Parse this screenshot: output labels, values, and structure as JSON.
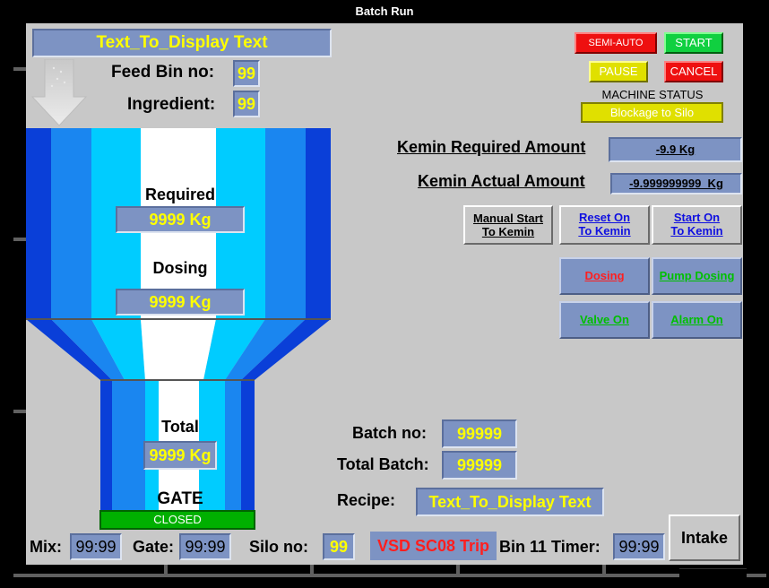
{
  "window": {
    "title": "Batch Run"
  },
  "header": {
    "display_text": "Text_To_Display Text"
  },
  "feed": {
    "label": "Feed Bin no:",
    "value": "99",
    "ingredient_label": "Ingredient:",
    "ingredient_value": "99"
  },
  "hopper": {
    "required_label": "Required",
    "required_value": "9999 Kg",
    "dosing_label": "Dosing",
    "dosing_value": "9999 Kg",
    "total_label": "Total",
    "total_value": "9999 Kg",
    "gate_label": "GATE",
    "gate_status": "CLOSED"
  },
  "controls": {
    "semi_auto": "SEMI-AUTO",
    "start": "START",
    "pause": "PAUSE",
    "cancel": "CANCEL",
    "machine_status_label": "MACHINE STATUS",
    "machine_status_value": "Blockage to Silo"
  },
  "kemin": {
    "required_label": "Kemin Required Amount",
    "required_value": "-9.9 Kg",
    "actual_label": "Kemin Actual Amount",
    "actual_value": "-9.999999999  Kg",
    "manual_start_l1": "Manual Start",
    "manual_start_l2": "To Kemin",
    "reset_l1": "Reset On",
    "reset_l2": "To Kemin",
    "start_l1": "Start On",
    "start_l2": "To Kemin"
  },
  "indicators": {
    "dosing": "Dosing",
    "pump_dosing": "Pump Dosing",
    "valve_on": "Valve On",
    "alarm_on": "Alarm On"
  },
  "batch": {
    "batch_no_label": "Batch no:",
    "batch_no_value": "99999",
    "total_batch_label": "Total Batch:",
    "total_batch_value": "99999",
    "recipe_label": "Recipe:",
    "recipe_value": "Text_To_Display Text"
  },
  "footer": {
    "mix_label": "Mix:",
    "mix_value": "99:99",
    "gate_label": "Gate:",
    "gate_value": "99:99",
    "silo_label": "Silo no:",
    "silo_value": "99",
    "alarm_text": "VSD SC08 Trip",
    "bin_timer_label": "Bin 11 Timer:",
    "bin_timer_value": "99:99",
    "intake": "Intake"
  },
  "colors": {
    "panel": "#c8c8c8",
    "field": "#7d93c3",
    "value_text": "#ffff00",
    "alarm_red": "#ff1f1f",
    "ok_green": "#00c000",
    "bin_dark": "#0a3fd8",
    "bin_mid": "#1a86f0",
    "bin_light": "#00ccff"
  },
  "icons": {
    "arrow": "down-arrow-icon"
  }
}
